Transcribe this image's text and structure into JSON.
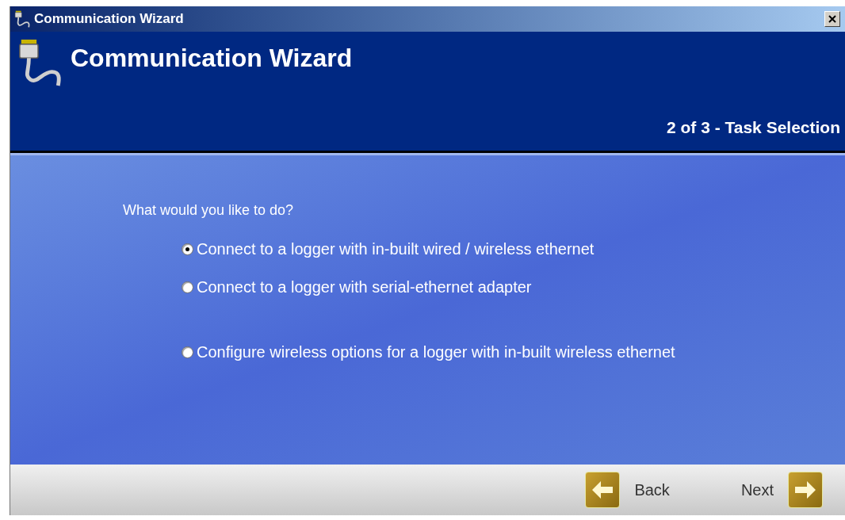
{
  "window": {
    "title": "Communication Wizard"
  },
  "header": {
    "title": "Communication Wizard",
    "step": "2 of 3 - Task Selection"
  },
  "question": "What would you like to do?",
  "option_groups": [
    [
      {
        "label": "Connect to a logger with in-built wired / wireless ethernet",
        "selected": true
      },
      {
        "label": "Connect to a logger with serial-ethernet adapter",
        "selected": false
      }
    ],
    [
      {
        "label": "Configure wireless options for a logger with in-built wireless ethernet",
        "selected": false
      }
    ]
  ],
  "footer": {
    "back": "Back",
    "next": "Next"
  }
}
